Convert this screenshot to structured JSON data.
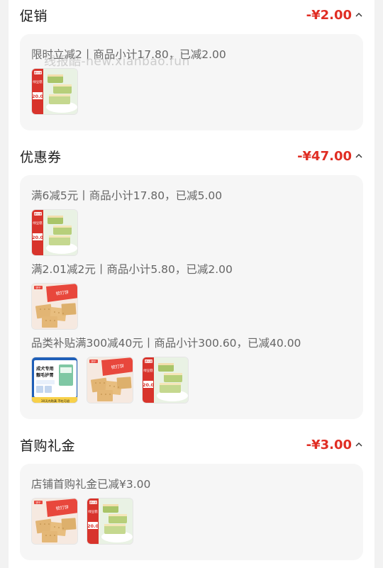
{
  "watermark": "线报酷-new.xianbao.fun",
  "sections": [
    {
      "title": "促销",
      "amount": "-¥2.00",
      "lines": [
        {
          "text": "限时立减2丨商品小计17.80，已减2.00",
          "thumbs": [
            "matcha-cake"
          ]
        }
      ]
    },
    {
      "title": "优惠券",
      "amount": "-¥47.00",
      "lines": [
        {
          "text": "满6减5元丨商品小计17.80，已减5.00",
          "thumbs": [
            "matcha-cake"
          ]
        },
        {
          "text": "满2.01减2元丨商品小计5.80，已减2.00",
          "thumbs": [
            "crackers"
          ]
        },
        {
          "text": "品类补贴满300减40元丨商品小计300.60，已减40.00",
          "thumbs": [
            "dog-food",
            "crackers",
            "matcha-cake"
          ]
        }
      ]
    },
    {
      "title": "首购礼金",
      "amount": "-¥3.00",
      "lines": [
        {
          "text": "店铺首购礼金已减¥3.00",
          "thumbs": [
            "crackers",
            "matcha-cake"
          ]
        }
      ]
    }
  ],
  "product_thumbs": {
    "matcha-cake": {
      "brand": "健元堂",
      "badge": "20.0",
      "tag": "绿豆糕"
    },
    "crackers": {
      "brand": "饼干",
      "tag": "梳打饼"
    },
    "dog-food": {
      "headline": "成犬专用",
      "subline": "靓毛护胃",
      "footer": "30天内购满 不吃可退"
    }
  },
  "colors": {
    "accent": "#e02e24",
    "card_bg": "#f6f6f6",
    "page_bg": "#f2f2f2"
  }
}
